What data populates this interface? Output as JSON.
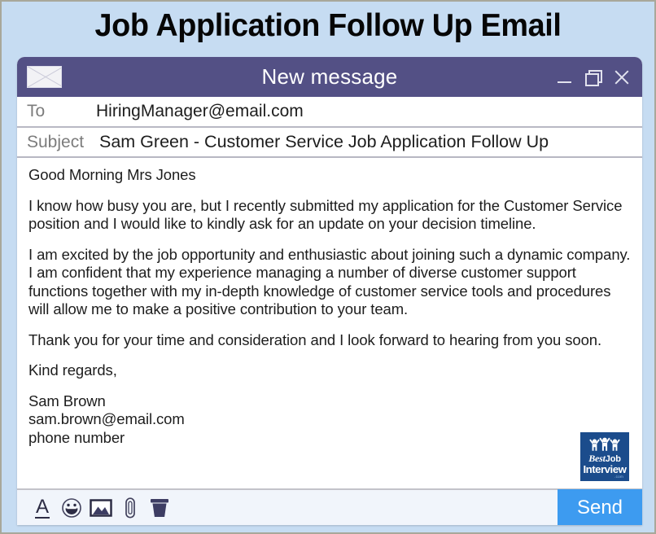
{
  "page": {
    "heading": "Job Application Follow Up Email",
    "background_color": "#c6dcf2"
  },
  "compose_window": {
    "titlebar": {
      "title": "New message",
      "background_color": "#535085",
      "icon": "envelope-icon",
      "controls": {
        "minimize": "minimize-icon",
        "restore": "restore-icon",
        "close": "close-icon"
      }
    },
    "fields": {
      "to": {
        "label": "To",
        "value": "HiringManager@email.com",
        "placeholder": "To"
      },
      "subject": {
        "label": "Subject",
        "value": "Sam Green - Customer Service Job Application Follow Up",
        "placeholder": "Subject"
      }
    },
    "body": {
      "greeting": "Good Morning Mrs Jones",
      "paragraph_1": "I know how busy you are, but I recently submitted my application for the Customer Service position and I would like to kindly ask for an update on your decision timeline.",
      "paragraph_2": "I am excited by the job opportunity and enthusiastic about joining such a dynamic company. I am confident that my experience managing a number of diverse customer support functions together with my in-depth knowledge of customer service tools and procedures will allow me to make a positive contribution to your team.",
      "paragraph_3": "Thank you for your time and consideration and I look forward to hearing from you soon.",
      "sign_off": "Kind regards,",
      "signature": "Sam Brown\nsam.brown@email.com\nphone number"
    },
    "logo": {
      "best": "Best",
      "job": "Job",
      "interview": "Interview",
      "dotcom": ".com",
      "background_color": "#1b4c8c"
    },
    "toolbar": {
      "icons": [
        {
          "name": "format-text-icon",
          "glyph": "A"
        },
        {
          "name": "emoji-icon",
          "glyph": ""
        },
        {
          "name": "insert-image-icon",
          "glyph": ""
        },
        {
          "name": "attach-file-icon",
          "glyph": ""
        },
        {
          "name": "delete-icon",
          "glyph": ""
        }
      ],
      "send_label": "Send",
      "send_color": "#3d9bf0"
    }
  }
}
